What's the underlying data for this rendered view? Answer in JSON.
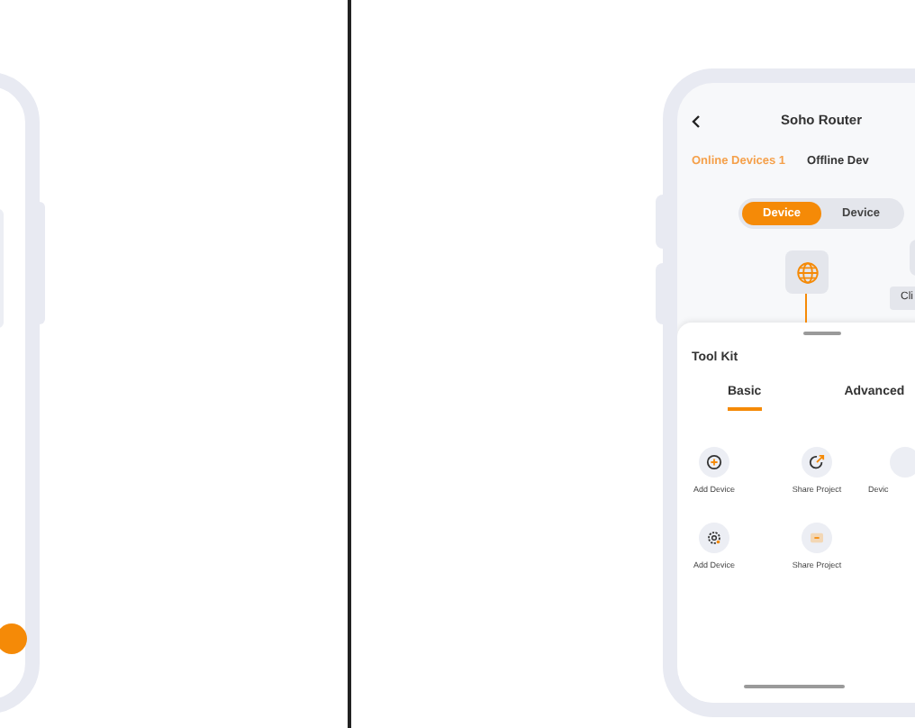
{
  "app": {
    "title": "Soho Router",
    "tabs": [
      {
        "label": "Online Devices 1",
        "selected": true
      },
      {
        "label": "Offline Dev",
        "selected": false
      }
    ],
    "view_toggle": [
      {
        "label": "Device",
        "selected": true
      },
      {
        "label": "Device",
        "selected": false
      }
    ],
    "topology": {
      "node_label": "Cli"
    },
    "toolkit": {
      "title": "Tool Kit",
      "tabs": [
        {
          "label": "Basic",
          "selected": true
        },
        {
          "label": "Advanced",
          "selected": false
        }
      ],
      "tools": [
        {
          "label": "Add Device",
          "kind": "add"
        },
        {
          "label": "Share Project",
          "kind": "share"
        },
        {
          "label": "Devic",
          "kind": "blank"
        },
        {
          "label": "Add Device",
          "kind": "settings"
        },
        {
          "label": "Share Project",
          "kind": "card"
        }
      ]
    }
  }
}
